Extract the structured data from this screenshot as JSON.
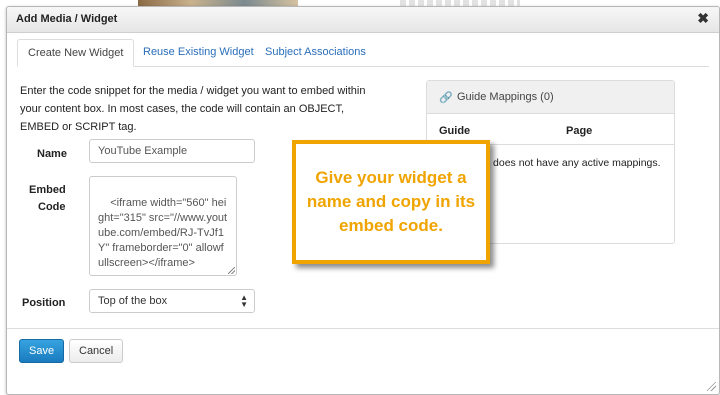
{
  "dialog": {
    "title": "Add Media / Widget",
    "close_glyph": "✖"
  },
  "tabs": [
    {
      "label": "Create New Widget",
      "active": true
    },
    {
      "label": "Reuse Existing Widget",
      "active": false
    },
    {
      "label": "Subject Associations",
      "active": false
    }
  ],
  "intro": "Enter the code snippet for the media / widget you want to embed within your content box. In most cases, the code will contain an OBJECT, EMBED or SCRIPT tag.",
  "form": {
    "name_label": "Name",
    "name_value": "YouTube Example",
    "embed_label_line1": "Embed",
    "embed_label_line2": "Code",
    "embed_value": "<iframe width=\"560\" height=\"315\" src=\"//www.youtube.com/embed/RJ-TvJf1Y\" frameborder=\"0\" allowfullscreen></iframe>",
    "position_label": "Position",
    "position_value": "Top of the box"
  },
  "mappings": {
    "title": "Guide Mappings (0)",
    "col_guide": "Guide",
    "col_page": "Page",
    "empty_text": "This widget does not have any active mappings."
  },
  "callout": {
    "text": "Give your widget a name and copy in its embed code.",
    "color": "#f0a400"
  },
  "buttons": {
    "save": "Save",
    "cancel": "Cancel"
  },
  "colors": {
    "link": "#2a6ebb",
    "primary": "#1a7bbf"
  }
}
